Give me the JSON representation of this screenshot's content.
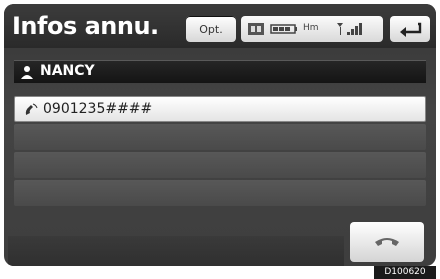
{
  "header": {
    "title": "Infos annu.",
    "options_label": "Opt.",
    "status": {
      "bluetooth_icon": "bluetooth-icon",
      "battery_icon": "battery-icon",
      "network_label": "Hm",
      "signal_icon": "signal-icon"
    },
    "back_icon": "back-arrow-icon"
  },
  "contact": {
    "person_icon": "person-icon",
    "name": "NANCY"
  },
  "numbers": [
    {
      "icon": "mobile-phone-icon",
      "value": "0901235####"
    }
  ],
  "actions": {
    "call_icon": "handset-icon"
  },
  "footer": {
    "code": "D100620"
  },
  "colors": {
    "header_bg": "#2a2a2a",
    "panel_bg": "#444444",
    "name_bar_bg": "#141414",
    "row_active_bg": "#ffffff"
  }
}
